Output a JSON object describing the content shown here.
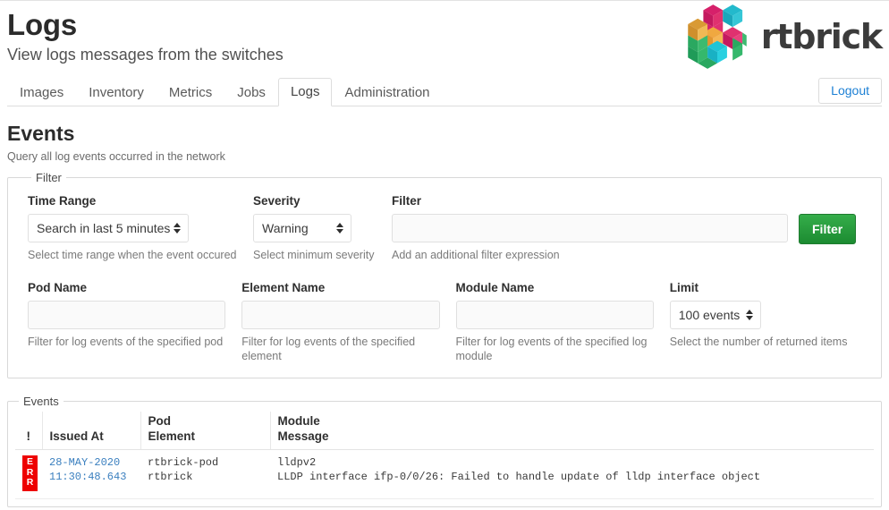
{
  "header": {
    "title": "Logs",
    "subtitle": "View logs messages from the switches",
    "brand_name": "rtbrick",
    "logout_label": "Logout",
    "tabs": [
      {
        "label": "Images",
        "active": false
      },
      {
        "label": "Inventory",
        "active": false
      },
      {
        "label": "Metrics",
        "active": false
      },
      {
        "label": "Jobs",
        "active": false
      },
      {
        "label": "Logs",
        "active": true
      },
      {
        "label": "Administration",
        "active": false
      }
    ]
  },
  "section": {
    "title": "Events",
    "description": "Query all log events occurred in the network"
  },
  "filter": {
    "legend": "Filter",
    "time_range": {
      "label": "Time Range",
      "value": "Search in last 5 minutes",
      "help": "Select time range when the event occured"
    },
    "severity": {
      "label": "Severity",
      "value": "Warning",
      "help": "Select minimum severity"
    },
    "expression": {
      "label": "Filter",
      "value": "",
      "placeholder": "",
      "help": "Add an additional filter expression"
    },
    "submit_label": "Filter",
    "pod_name": {
      "label": "Pod Name",
      "value": "",
      "placeholder": "",
      "help": "Filter for log events of the specified pod"
    },
    "element_name": {
      "label": "Element Name",
      "value": "",
      "placeholder": "",
      "help": "Filter for log events of the specified element"
    },
    "module_name": {
      "label": "Module Name",
      "value": "",
      "placeholder": "",
      "help": "Filter for log events of the specified log module"
    },
    "limit": {
      "label": "Limit",
      "value": "100 events",
      "help": "Select the number of returned items"
    }
  },
  "events": {
    "legend": "Events",
    "columns": {
      "severity": "!",
      "issued_at": "Issued At",
      "pod": "Pod",
      "element": "Element",
      "module": "Module",
      "message": "Message"
    },
    "rows": [
      {
        "severity": "ERR",
        "severity_color": "#ee0000",
        "date": "28-MAY-2020",
        "time": "11:30:48.643",
        "pod": "rtbrick-pod",
        "element": "rtbrick",
        "module": "lldpv2",
        "message": "LLDP interface ifp-0/0/26: Failed to handle update of lldp interface object"
      }
    ]
  }
}
